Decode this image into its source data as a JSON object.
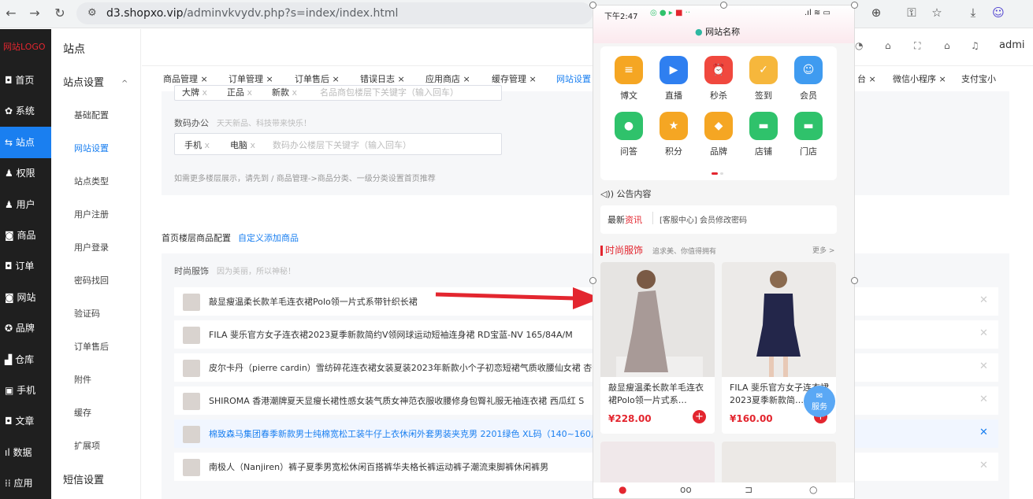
{
  "browser": {
    "url_prefix": "d3.shopxo.vip",
    "url_rest": "/adminvkvydv.php?s=index/index.html",
    "admin_text": "admi"
  },
  "sidebar": {
    "logo": "网站LOGO",
    "items": [
      {
        "icon": "home-icon",
        "glyph": "◘",
        "label": "首页"
      },
      {
        "icon": "gear-icon",
        "glyph": "✿",
        "label": "系统"
      },
      {
        "icon": "sliders-icon",
        "glyph": "⇆",
        "label": "站点"
      },
      {
        "icon": "user-lock-icon",
        "glyph": "♟",
        "label": "权限"
      },
      {
        "icon": "user-icon",
        "glyph": "♟",
        "label": "用户"
      },
      {
        "icon": "box-icon",
        "glyph": "◙",
        "label": "商品"
      },
      {
        "icon": "order-icon",
        "glyph": "◘",
        "label": "订单"
      },
      {
        "icon": "chat-icon",
        "glyph": "◙",
        "label": "网站"
      },
      {
        "icon": "brand-icon",
        "glyph": "✪",
        "label": "品牌"
      },
      {
        "icon": "warehouse-icon",
        "glyph": "▟",
        "label": "仓库"
      },
      {
        "icon": "phone-icon",
        "glyph": "▣",
        "label": "手机"
      },
      {
        "icon": "article-icon",
        "glyph": "◘",
        "label": "文章"
      },
      {
        "icon": "chart-icon",
        "glyph": "ıl",
        "label": "数据"
      },
      {
        "icon": "apps-icon",
        "glyph": "⁞⁞",
        "label": "应用"
      }
    ]
  },
  "subnav": {
    "title": "站点",
    "section": "站点设置",
    "items": [
      "基础配置",
      "网站设置",
      "站点类型",
      "用户注册",
      "用户登录",
      "密码找回",
      "验证码",
      "订单售后",
      "附件",
      "缓存",
      "扩展项"
    ],
    "footer_section": "短信设置"
  },
  "tabs": [
    "商品管理",
    "订单管理",
    "订单售后",
    "错误日志",
    "应用商店",
    "缓存管理",
    "网站设置",
    "台",
    "微信小程序",
    "支付宝小"
  ],
  "content": {
    "top_tags": [
      "大牌",
      "正品",
      "新款"
    ],
    "top_placeholder": "名品商包楼层下关键字（输入回车）",
    "digital": {
      "label": "数码办公",
      "hint": "天天新品、科技带来快乐！",
      "tags": [
        "手机",
        "电脑"
      ],
      "placeholder": "数码办公楼层下关键字（输入回车）"
    },
    "tip": "如需更多楼层展示，请先到 / 商品管理->商品分类、一级分类设置首页推荐",
    "floor_config_label": "首页楼层商品配置",
    "custom_add_link": "自定义添加商品",
    "fashion_label": "时尚服饰",
    "fashion_hint": "因为美丽，所以神秘！",
    "products": [
      "敲显瘦温柔长款羊毛连衣裙Polo领一片式系带针织长裙",
      "FILA 斐乐官方女子连衣裙2023夏季新款简约V领网球运动短袖连身裙 RD宝蓝-NV 165/84A/M",
      "皮尔卡丹（pierre cardin）雪纺碎花连衣裙女装夏装2023年新款小个子初恋短裙气质收腰仙女裙 杏色",
      "SHIROMA 香港潮牌夏天显瘦长裙性感女装气质女神范衣服收腰修身包臀礼服无袖连衣裙 西瓜红 S",
      "棉致森马集团春季新款男士纯棉宽松工装牛仔上衣休闲外套男装夹克男 2201绿色 XL码（140~160斤）",
      "南极人（Nanjiren）裤子夏季男宽松休闲百搭裤华夫格长裤运动裤子潮流束脚裤休闲裤男"
    ]
  },
  "phone": {
    "time": "下午2:47",
    "site_name": "网站名称",
    "grid": [
      {
        "label": "博文",
        "icon": "article-icon",
        "color": "#f5a623"
      },
      {
        "label": "直播",
        "icon": "live-icon",
        "color": "#2f7ff0"
      },
      {
        "label": "秒杀",
        "icon": "alarm-icon",
        "color": "#f0483e"
      },
      {
        "label": "签到",
        "icon": "checkin-icon",
        "color": "#f6b73c"
      },
      {
        "label": "会员",
        "icon": "member-icon",
        "color": "#3f9bf0"
      },
      {
        "label": "问答",
        "icon": "qa-icon",
        "color": "#2fc26b"
      },
      {
        "label": "积分",
        "icon": "points-icon",
        "color": "#f5a623"
      },
      {
        "label": "品牌",
        "icon": "brand-icon",
        "color": "#f5a623"
      },
      {
        "label": "店铺",
        "icon": "shop-icon",
        "color": "#2fc26b"
      },
      {
        "label": "门店",
        "icon": "store-icon",
        "color": "#2fc26b"
      }
    ],
    "notice_title": "公告内容",
    "news_prefix": "最新",
    "news_highlight": "资讯",
    "news_text": "[客服中心] 会员修改密码",
    "section_title": "时尚服饰",
    "section_sub": "追求美、你值得拥有",
    "more": "更多 >",
    "products": [
      {
        "name": "敲显瘦温柔长款羊毛连衣裙Polo领一片式系…",
        "price": "¥228.00"
      },
      {
        "name": "FILA 斐乐官方女子连衣裙2023夏季新款简…",
        "price": "¥160.00"
      }
    ],
    "service_label": "服务"
  }
}
